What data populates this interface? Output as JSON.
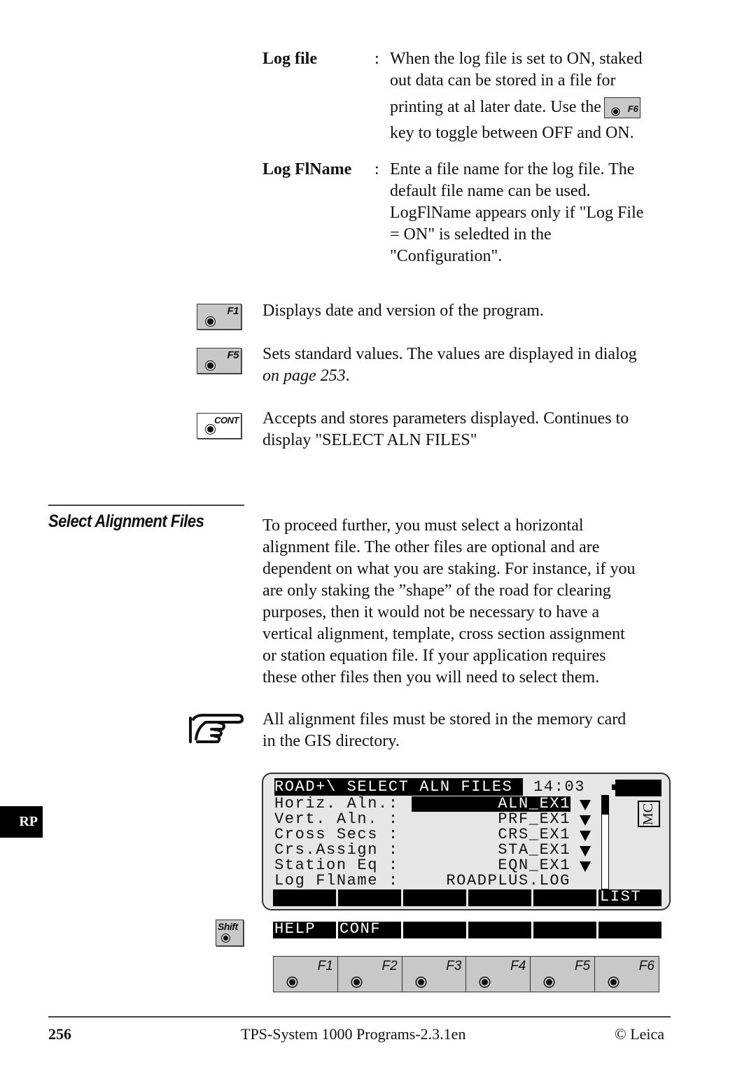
{
  "definitions": [
    {
      "term": "Log file",
      "colon": ":",
      "lines": [
        "When the log file is set to ON, staked",
        "out data can be stored in a file for",
        "printing at al later date. Use the",
        "key to toggle between OFF and ON."
      ],
      "inline_key": "F6"
    },
    {
      "term": "Log FlName",
      "colon": ":",
      "lines": [
        "Ente a file name for the log file. The",
        "default file name can be used.",
        "LogFlName appears only if \"Log File",
        "= ON\" is seledted in the",
        "\"Configuration\"."
      ]
    }
  ],
  "key_descriptions": [
    {
      "key": "F1",
      "lines": [
        "Displays date and version of the program."
      ]
    },
    {
      "key": "F5",
      "lines": [
        "Sets standard values. The values are displayed in dialog"
      ],
      "italic_line": "on page 253",
      "italic_suffix": "."
    },
    {
      "key": "CONT",
      "lines": [
        "Accepts and stores parameters displayed. Continues to",
        "display \"SELECT ALN FILES\""
      ]
    }
  ],
  "section": {
    "title": "Select Alignment Files",
    "paragraph": [
      "To proceed further, you must select a horizontal",
      "alignment file. The other files are optional and are",
      "dependent on what you are staking. For instance, if you",
      "are only staking the ”shape” of the road for clearing",
      "purposes, then it would not be necessary to have a",
      "vertical alignment, template, cross section assignment",
      "or station equation file. If your application requires",
      "these other files then you will need to select them."
    ],
    "note": [
      "All alignment files must be stored in the memory card",
      "in the GIS directory."
    ]
  },
  "side_tab": "RP",
  "lcd": {
    "title": "ROAD+\\ SELECT ALN FILES ",
    "time": "14:03",
    "memory_indicator": "MC",
    "rows": [
      {
        "label": "Horiz. Aln.:",
        "value": "ALN_EX1",
        "selected": true,
        "dropdown": true
      },
      {
        "label": "Vert. Aln. :",
        "value": "PRF_EX1",
        "dropdown": true
      },
      {
        "label": "Cross Secs :",
        "value": "CRS_EX1",
        "dropdown": true
      },
      {
        "label": "Crs.Assign :",
        "value": "STA_EX1",
        "dropdown": true
      },
      {
        "label": "Station Eq :",
        "value": "EQN_EX1",
        "dropdown": true
      },
      {
        "label": "Log FlName :",
        "value": "ROADPLUS.LOG",
        "dropdown": false
      }
    ],
    "softkeys": [
      "",
      "",
      "",
      "",
      "",
      "LIST"
    ],
    "scroll_fraction": 0.2
  },
  "shift_key": "Shift",
  "shift_softkeys": [
    "HELP",
    "CONF",
    "",
    "",
    "",
    ""
  ],
  "function_keys": [
    "F1",
    "F2",
    "F3",
    "F4",
    "F5",
    "F6"
  ],
  "footer": {
    "page_number": "256",
    "title": "TPS-System 1000 Programs-2.3.1en",
    "copyright": "© Leica"
  }
}
